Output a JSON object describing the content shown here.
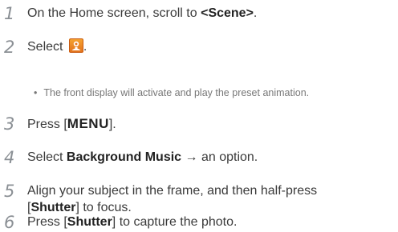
{
  "steps": [
    {
      "num": "1",
      "pre": "On the Home screen, scroll to ",
      "bold": "<Scene>",
      "post": "."
    },
    {
      "num": "2",
      "pre": "Select ",
      "post": "."
    },
    {
      "num": "3",
      "pre": "Press [",
      "key": "MENU",
      "post": "]."
    },
    {
      "num": "4",
      "pre": "Select ",
      "bold": "Background Music",
      "post": " → an option."
    },
    {
      "num": "5",
      "line1": "Align your subject in the frame, and then half-press",
      "line2_pre": "[",
      "line2_bold": "Shutter",
      "line2_post": "] to focus."
    },
    {
      "num": "6",
      "pre": "Press [",
      "bold": "Shutter",
      "post": "] to capture the photo."
    }
  ],
  "note": {
    "bullet": "•",
    "text": "The front display will activate and play the preset animation."
  },
  "icons": {
    "scene_icon": "scene-mode-icon",
    "scene_icon_color": "#f08a24"
  }
}
